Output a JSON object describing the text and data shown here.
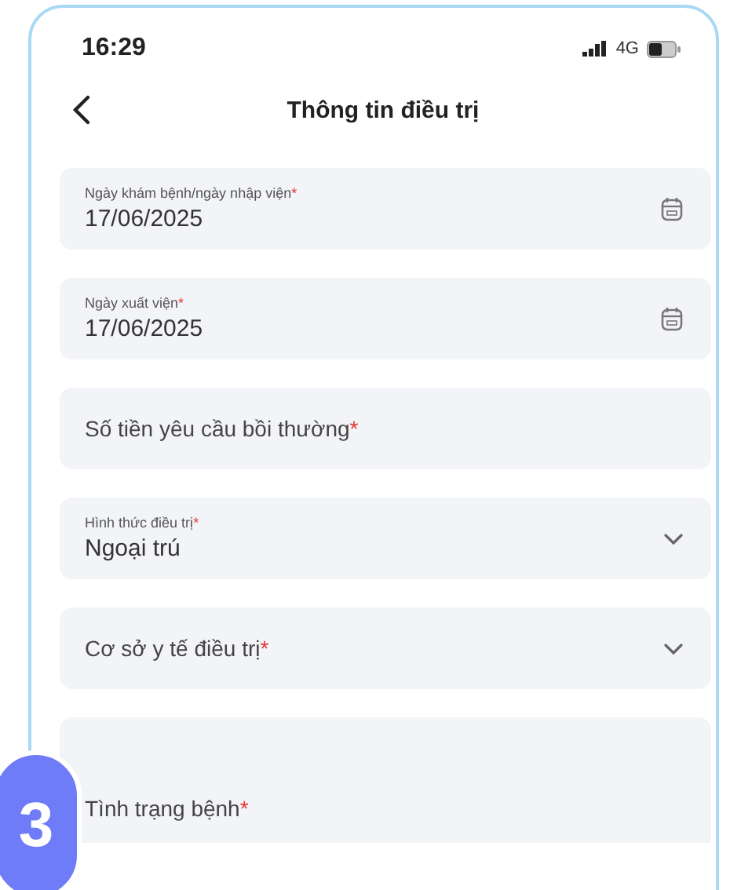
{
  "status_bar": {
    "time": "16:29",
    "network": "4G"
  },
  "header": {
    "title": "Thông tin điều trị"
  },
  "fields": [
    {
      "kind": "date",
      "label": "Ngày khám bệnh/ngày nhập viện",
      "required_mark": "*",
      "value": "17/06/2025"
    },
    {
      "kind": "date",
      "label": "Ngày xuất viện",
      "required_mark": "*",
      "value": "17/06/2025"
    },
    {
      "kind": "text",
      "label": "Số tiền yêu cầu bồi thường",
      "required_mark": "*"
    },
    {
      "kind": "select",
      "label": "Hình thức điều trị",
      "required_mark": "*",
      "value": "Ngoại trú"
    },
    {
      "kind": "select",
      "label": "Cơ sở y tế điều trị",
      "required_mark": "*"
    },
    {
      "kind": "textarea",
      "label": "Tình trạng bệnh",
      "required_mark": "*"
    }
  ],
  "step_badge": {
    "number": "3"
  }
}
